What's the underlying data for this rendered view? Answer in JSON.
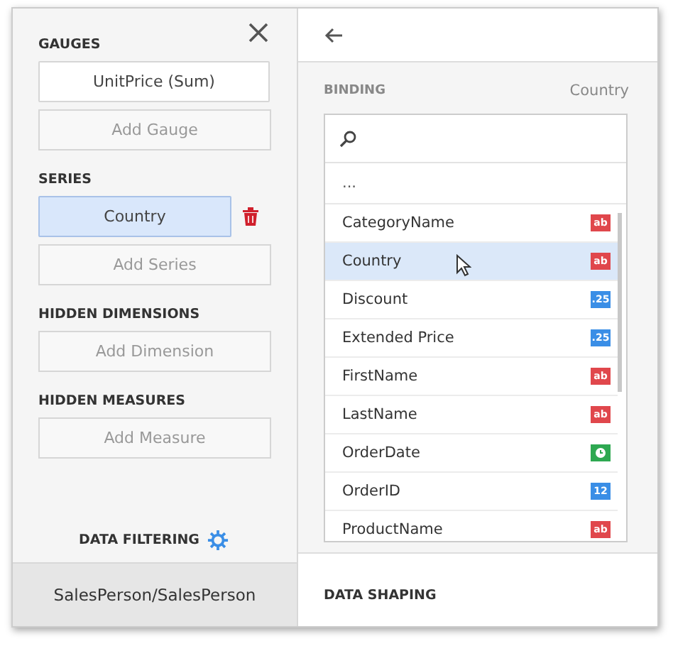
{
  "left_panel": {
    "sections": [
      {
        "title": "GAUGES",
        "items": [
          {
            "label": "UnitPrice (Sum)",
            "selected": false
          }
        ],
        "add_label": "Add Gauge"
      },
      {
        "title": "SERIES",
        "items": [
          {
            "label": "Country",
            "selected": true
          }
        ],
        "add_label": "Add Series"
      },
      {
        "title": "HIDDEN DIMENSIONS",
        "add_label": "Add Dimension"
      },
      {
        "title": "HIDDEN MEASURES",
        "add_label": "Add Measure"
      }
    ],
    "filtering_label": "DATA FILTERING",
    "footer": "SalesPerson/SalesPerson"
  },
  "right_panel": {
    "binding_label": "BINDING",
    "binding_value": "Country",
    "empty_option": "...",
    "fields": [
      {
        "name": "CategoryName",
        "kind": "string",
        "badge": "ab",
        "selected": false
      },
      {
        "name": "Country",
        "kind": "string",
        "badge": "ab",
        "selected": true
      },
      {
        "name": "Discount",
        "kind": "number",
        "badge": ".25",
        "selected": false
      },
      {
        "name": "Extended Price",
        "kind": "number",
        "badge": ".25",
        "selected": false
      },
      {
        "name": "FirstName",
        "kind": "string",
        "badge": "ab",
        "selected": false
      },
      {
        "name": "LastName",
        "kind": "string",
        "badge": "ab",
        "selected": false
      },
      {
        "name": "OrderDate",
        "kind": "date",
        "selected": false
      },
      {
        "name": "OrderID",
        "kind": "integer",
        "badge": "12",
        "selected": false
      },
      {
        "name": "ProductName",
        "kind": "string",
        "badge": "ab",
        "selected": false
      }
    ],
    "shaping_label": "DATA SHAPING"
  }
}
